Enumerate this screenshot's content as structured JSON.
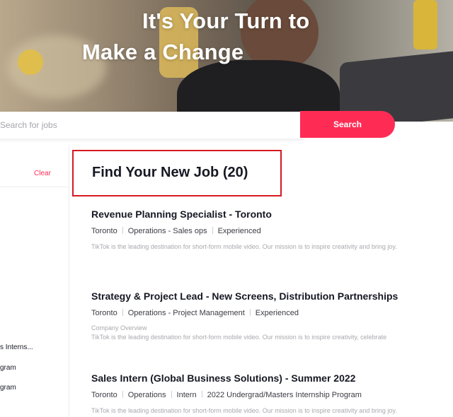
{
  "hero": {
    "title_line1": "It's Your Turn to",
    "title_line2": "Make a Change"
  },
  "search": {
    "placeholder": "Search for jobs",
    "button_label": "Search"
  },
  "sidebar": {
    "clear_label": "Clear",
    "items": [
      {
        "label": "s Interns..."
      },
      {
        "label": "gram"
      },
      {
        "label": "gram"
      }
    ]
  },
  "results": {
    "title": "Find Your New Job (20)"
  },
  "jobs": [
    {
      "title": "Revenue Planning Specialist - Toronto",
      "tags": [
        "Toronto",
        "Operations - Sales ops",
        "Experienced"
      ],
      "subheading": "",
      "description": "TikTok is the leading destination for short-form mobile video. Our mission is to inspire creativity and bring joy."
    },
    {
      "title": "Strategy & Project Lead - New Screens, Distribution Partnerships",
      "tags": [
        "Toronto",
        "Operations - Project Management",
        "Experienced"
      ],
      "subheading": "Company Overview",
      "description": "TikTok is the leading destination for short-form mobile video. Our mission is to inspire creativity, celebrate"
    },
    {
      "title": "Sales Intern (Global Business Solutions) - Summer 2022",
      "tags": [
        "Toronto",
        "Operations",
        "Intern",
        "2022 Undergrad/Masters Internship Program"
      ],
      "subheading": "",
      "description": "TikTok is the leading destination for short-form mobile video. Our mission is to inspire creativity and bring joy."
    }
  ],
  "colors": {
    "accent": "#fe2c55",
    "highlight_border": "#d71a21"
  }
}
